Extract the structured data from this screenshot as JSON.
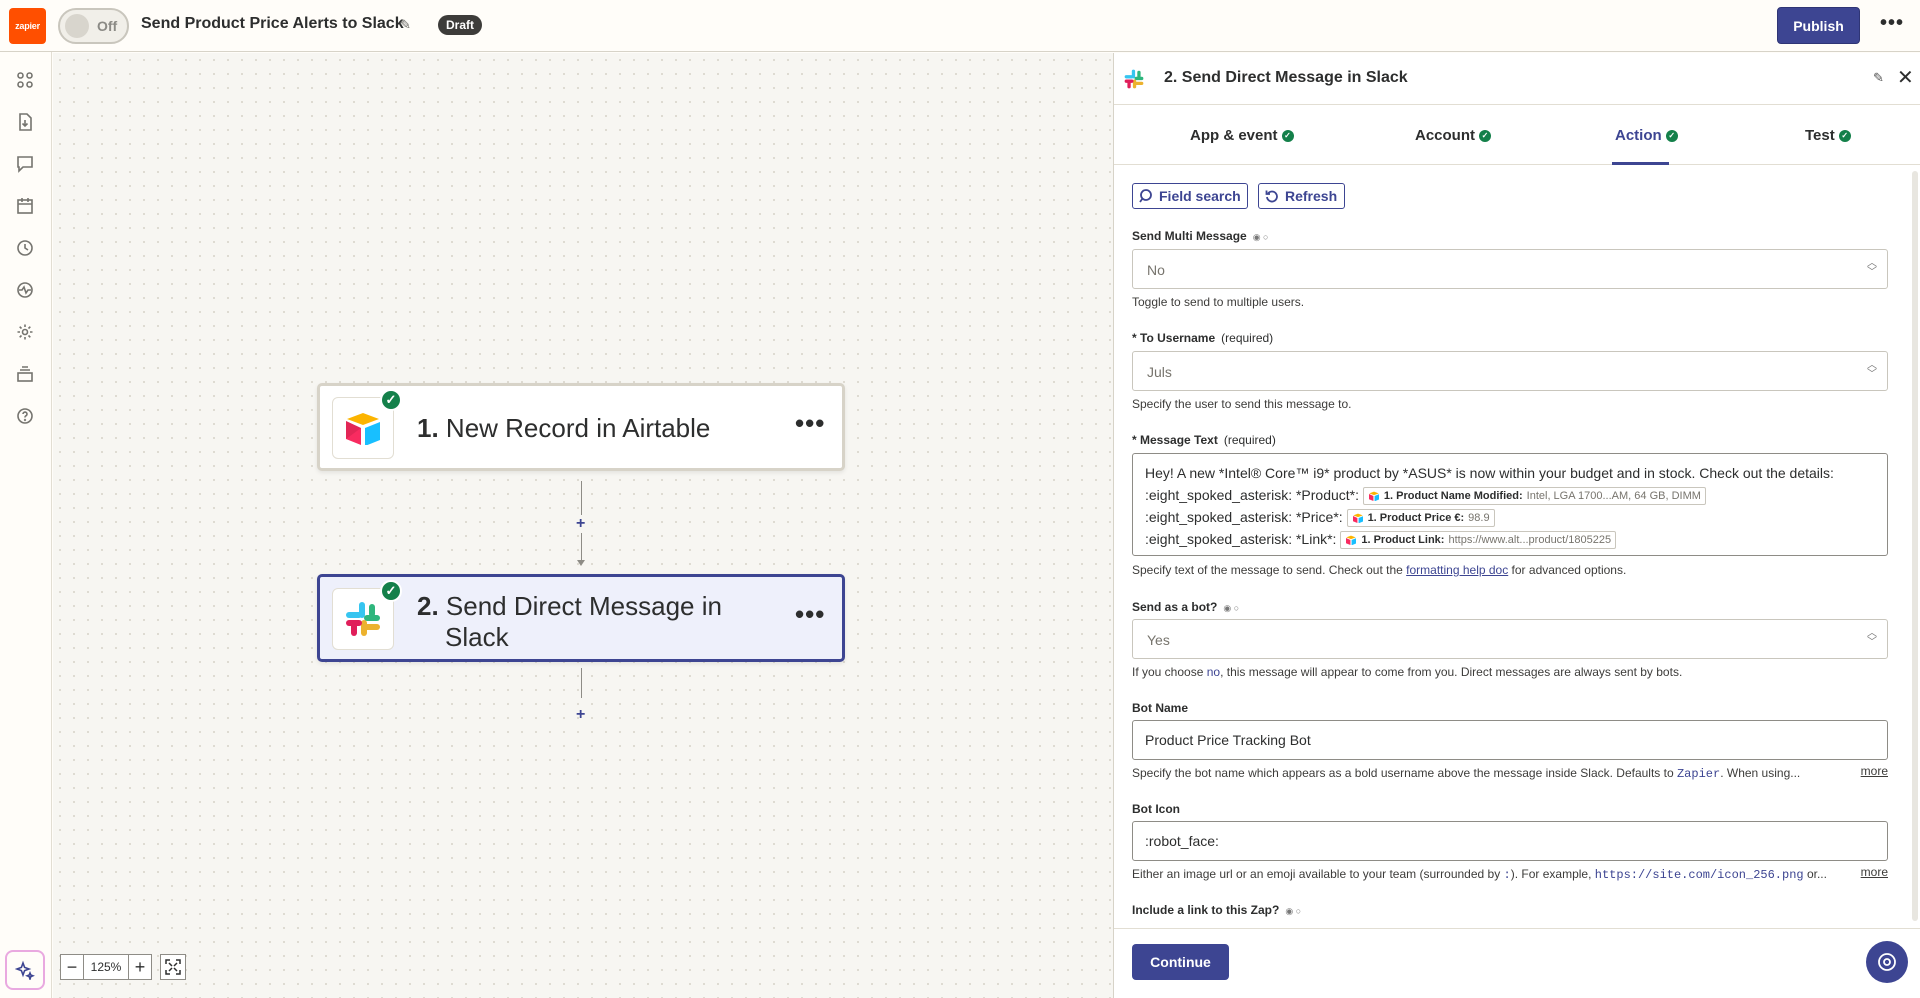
{
  "topbar": {
    "logo_text": "zapier",
    "toggle_label": "Off",
    "zap_title": "Send Product Price Alerts to Slack",
    "status_badge": "Draft",
    "publish_label": "Publish",
    "more_label": "•••"
  },
  "canvas": {
    "steps": [
      {
        "number": "1.",
        "title": "New Record in Airtable",
        "app": "airtable-icon",
        "status": "complete"
      },
      {
        "number": "2.",
        "title_line1": "Send Direct Message in",
        "title_line2": "Slack",
        "app": "slack-icon",
        "status": "complete"
      }
    ],
    "step_menu": "•••",
    "add_step": "+",
    "zoom": {
      "minus": "−",
      "value": "125%",
      "plus": "+"
    }
  },
  "panel": {
    "title": "2. Send Direct Message in Slack",
    "tabs": [
      {
        "label": "App & event",
        "complete": true
      },
      {
        "label": "Account",
        "complete": true
      },
      {
        "label": "Action",
        "complete": true,
        "active": true
      },
      {
        "label": "Test",
        "complete": true
      }
    ],
    "field_search_label": "Field search",
    "refresh_label": "Refresh",
    "fields": {
      "send_multi": {
        "label": "Send Multi Message",
        "value": "No",
        "help": "Toggle to send to multiple users."
      },
      "to_username": {
        "label": "To Username",
        "required": "(required)",
        "value": "Juls",
        "help": "Specify the user to send this message to."
      },
      "message_text": {
        "label": "Message Text",
        "required": "(required)",
        "line1": "Hey! A new *Intel® Core™ i9* product by *ASUS* is now within your budget and in stock. Check out the details:",
        "line2_prefix": ":eight_spoked_asterisk: *Product*:",
        "line2_pill_label": "1. Product Name Modified:",
        "line2_pill_value": "Intel, LGA 1700...AM, 64 GB, DIMM",
        "line3_prefix": ":eight_spoked_asterisk: *Price*:",
        "line3_pill_label": "1. Product Price €:",
        "line3_pill_value": "98.9",
        "line4_prefix": ":eight_spoked_asterisk: *Link*:",
        "line4_pill_label": "1. Product Link:",
        "line4_pill_value": "https://www.alt...product/1805225",
        "help_before": "Specify text of the message to send. Check out the ",
        "help_link": "formatting help doc",
        "help_after": " for advanced options."
      },
      "send_as_bot": {
        "label": "Send as a bot?",
        "value": "Yes",
        "help_before": "If you choose ",
        "help_no": "no",
        "help_after": ", this message will appear to come from you. Direct messages are always sent by bots."
      },
      "bot_name": {
        "label": "Bot Name",
        "value": "Product Price Tracking Bot",
        "help_before": "Specify the bot name which appears as a bold username above the message inside Slack. Defaults to ",
        "help_code": "Zapier",
        "help_after": ". When using...",
        "more": "more"
      },
      "bot_icon": {
        "label": "Bot Icon",
        "value": ":robot_face:",
        "help_before": "Either an image url or an emoji available to your team (surrounded by ",
        "help_code1": ":",
        "help_mid": "). For example, ",
        "help_code2": "https://site.com/icon_256.png",
        "help_after": " or...",
        "more": "more"
      },
      "include_link": {
        "label": "Include a link to this Zap?"
      }
    },
    "continue_label": "Continue"
  },
  "colors": {
    "brand_orange": "#ff4f00",
    "primary": "#3d4592",
    "success": "#14804a"
  }
}
